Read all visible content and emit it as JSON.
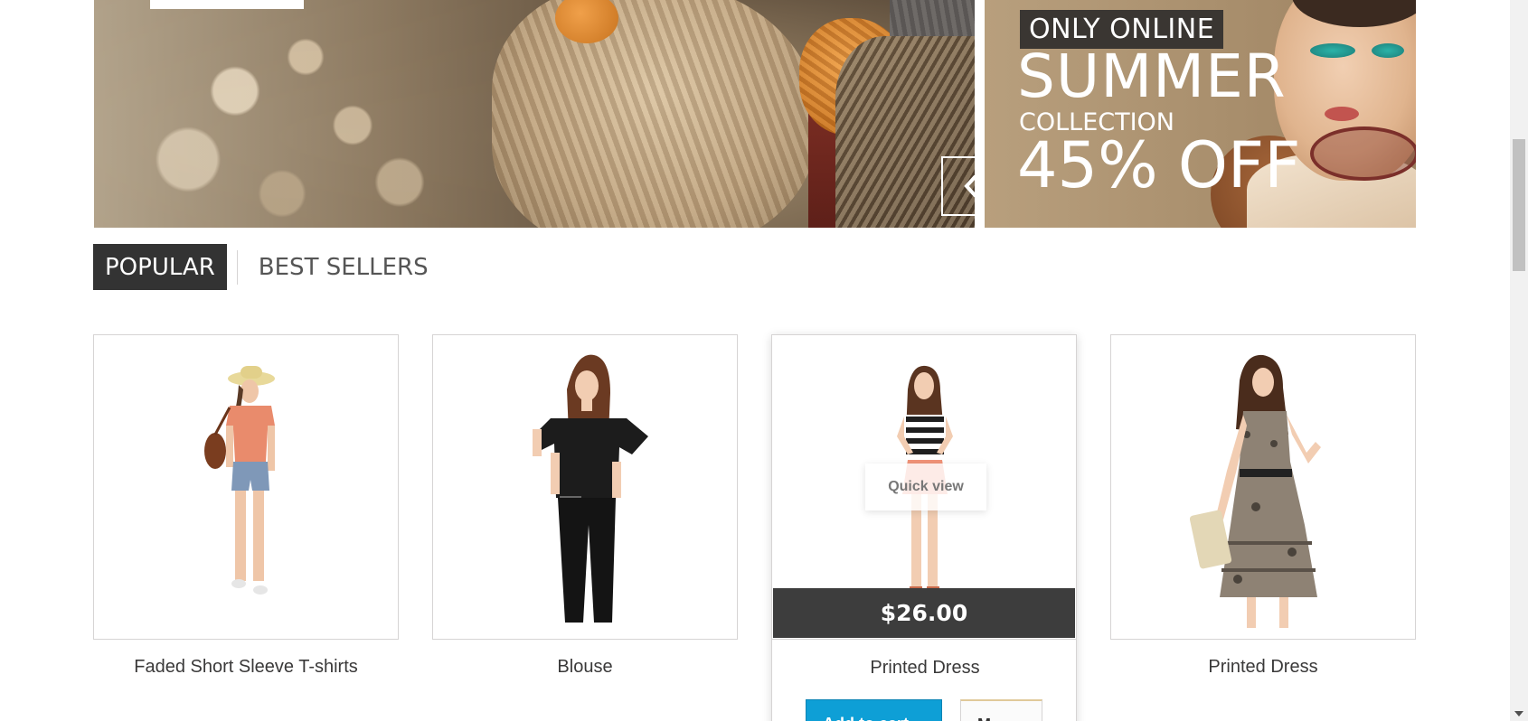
{
  "slider": {
    "prev_icon": "chevron-left-icon",
    "next_icon": "chevron-right-icon"
  },
  "promo": {
    "badge": "ONLY ONLINE",
    "line1": "SUMMER",
    "line2": "COLLECTION",
    "line3": "45% OFF"
  },
  "tabs": [
    {
      "label": "POPULAR",
      "active": true
    },
    {
      "label": "BEST SELLERS",
      "active": false
    }
  ],
  "products": [
    {
      "name": "Faded Short Sleeve T-shirts"
    },
    {
      "name": "Blouse"
    },
    {
      "name": "Printed Dress",
      "price": "$26.00",
      "quick_view": "Quick view",
      "add_to_cart": "Add to cart",
      "more": "More"
    },
    {
      "name": "Printed Dress"
    }
  ],
  "colors": {
    "accent": "#0e9fd6",
    "tab_active_bg": "#333333",
    "price_band": "#3d3d3d"
  }
}
